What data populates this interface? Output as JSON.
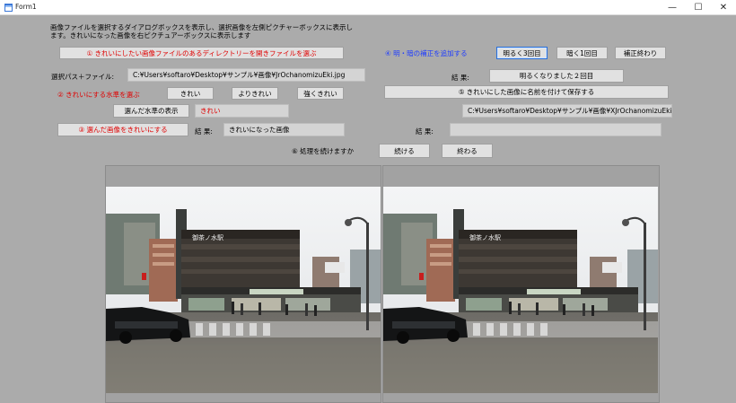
{
  "window": {
    "title": "Form1",
    "minimize": "—",
    "maximize": "☐",
    "close": "✕"
  },
  "description": "画像ファイルを選択するダイアログボックスを表示し、選択画像を左側ピクチャーボックスに表示します。きれいになった画像を右ピクチュアーボックスに表示します",
  "step1": {
    "open_button": "① きれいにしたい画像ファイルのあるディレクトリーを開きファイルを選ぶ"
  },
  "path": {
    "label": "選択パス＋ファイル:",
    "value": "C:¥Users¥softaro¥Desktop¥サンプル¥画像¥JrOchanomizuEki.jpg"
  },
  "step2": {
    "label": "② きれいにする水準を選ぶ",
    "options": [
      "きれい",
      "よりきれい",
      "強くきれい"
    ],
    "show_button": "選んだ水準の表示",
    "selected_value": "きれい"
  },
  "step3": {
    "apply_button": "③ 選んだ画像をきれいにする",
    "result_label": "結 果:",
    "result_value": "きれいになった画像"
  },
  "step4": {
    "label": "④ 明・暗の補正を追加する",
    "brighter_button": "明るく3回目",
    "darker_button": "暗く1回目",
    "end_button": "補正終わり",
    "result_label": "結 果:",
    "result_value": "明るくなりました２回目"
  },
  "step5": {
    "save_button": "⑤ きれいにした画像に名前を付けて保存する",
    "save_path": "C:¥Users¥softaro¥Desktop¥サンプル¥画像¥XJrOchanomizuEki.jpg",
    "result_label": "結 果:",
    "result_value": ""
  },
  "step6": {
    "label": "⑥ 処理を続けますか",
    "continue_button": "続ける",
    "end_button": "終わる"
  },
  "photo": {
    "station_sign": "御茶ノ水駅"
  },
  "colors": {
    "form_background": "#ababab",
    "button_face": "#e1e1e1",
    "red_text": "#e00000",
    "blue_text": "#1e3cff"
  }
}
